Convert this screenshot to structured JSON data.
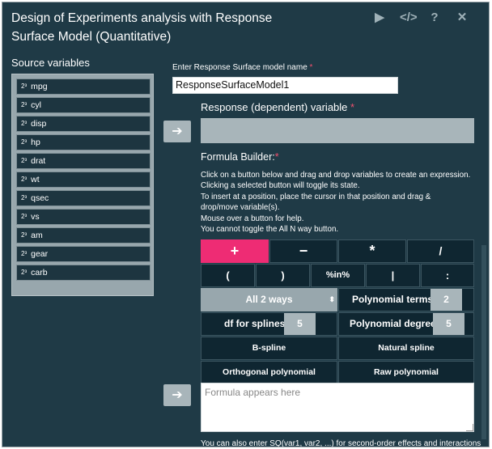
{
  "title": "Design of Experiments analysis with Response Surface Model (Quantitative)",
  "header_icons": [
    "play-icon",
    "code-icon",
    "help-icon",
    "close-icon"
  ],
  "source_variables": {
    "label": "Source variables",
    "items": [
      {
        "type_icon": "2³",
        "name": "mpg"
      },
      {
        "type_icon": "2³",
        "name": "cyl"
      },
      {
        "type_icon": "2³",
        "name": "disp"
      },
      {
        "type_icon": "2³",
        "name": "hp"
      },
      {
        "type_icon": "2³",
        "name": "drat"
      },
      {
        "type_icon": "2³",
        "name": "wt"
      },
      {
        "type_icon": "2³",
        "name": "qsec"
      },
      {
        "type_icon": "2³",
        "name": "vs"
      },
      {
        "type_icon": "2³",
        "name": "am"
      },
      {
        "type_icon": "2³",
        "name": "gear"
      },
      {
        "type_icon": "2³",
        "name": "carb"
      }
    ]
  },
  "model_name": {
    "label": "Enter Response Surface model name",
    "required": "*",
    "value": "ResponseSurfaceModel1"
  },
  "response": {
    "label": "Response (dependent) variable",
    "required": "*"
  },
  "arrow_glyph": "➔",
  "formula_builder": {
    "label": "Formula Builder:",
    "required": "*",
    "help": [
      "Click on a button below and drag and drop variables to create an expression.",
      "Clicking a selected button will toggle its state.",
      "To insert at a position, place the cursor in that position and drag &",
      "drop/move variable(s).",
      "Mouse over a button for help.",
      "You cannot toggle the All N way button."
    ],
    "ops_row1": [
      "+",
      "−",
      "*",
      "/"
    ],
    "ops_row2": [
      "(",
      ")",
      "%in%",
      "|",
      ":"
    ],
    "all_ways": "All 2 ways",
    "polynomial_terms": {
      "label": "Polynomial terms",
      "value": "2"
    },
    "df_splines": {
      "label": "df for splines",
      "value": "5"
    },
    "polynomial_degree": {
      "label": "Polynomial degree",
      "value": "5"
    },
    "bspline": "B-spline",
    "natural_spline": "Natural spline",
    "orthogonal_polynomial": "Orthogonal polynomial",
    "raw_polynomial": "Raw polynomial"
  },
  "formula_area": {
    "placeholder": "Formula appears here"
  },
  "footer_text": "You can also enter SQ(var1, var2, ...) for second-order effects and interactions",
  "colors": {
    "background": "#1f3a46",
    "accent": "#ee2c74",
    "panel": "#98a7ad"
  }
}
